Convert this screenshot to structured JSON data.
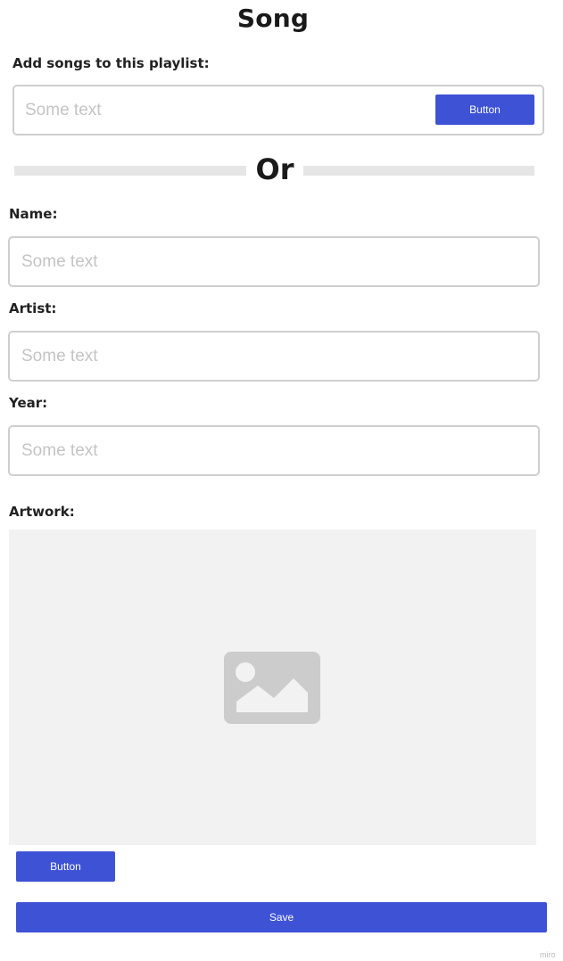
{
  "page": {
    "title": "Song"
  },
  "playlist_add": {
    "label": "Add songs to this playlist:",
    "input_placeholder": "Some text",
    "button_label": "Button"
  },
  "divider": {
    "text": "Or"
  },
  "form": {
    "name": {
      "label": "Name:",
      "placeholder": "Some text"
    },
    "artist": {
      "label": "Artist:",
      "placeholder": "Some text"
    },
    "year": {
      "label": "Year:",
      "placeholder": "Some text"
    },
    "artwork": {
      "label": "Artwork:",
      "icon": "image-placeholder-icon",
      "button_label": "Button"
    }
  },
  "actions": {
    "save_label": "Save"
  },
  "watermark": {
    "text": "miro"
  },
  "colors": {
    "accent": "#3d52d5",
    "placeholder_text": "#c4c4c4",
    "input_border": "#cfcfcf",
    "divider": "#e6e6e6",
    "artwork_bg": "#f2f2f2",
    "icon_gray": "#cccccc"
  }
}
